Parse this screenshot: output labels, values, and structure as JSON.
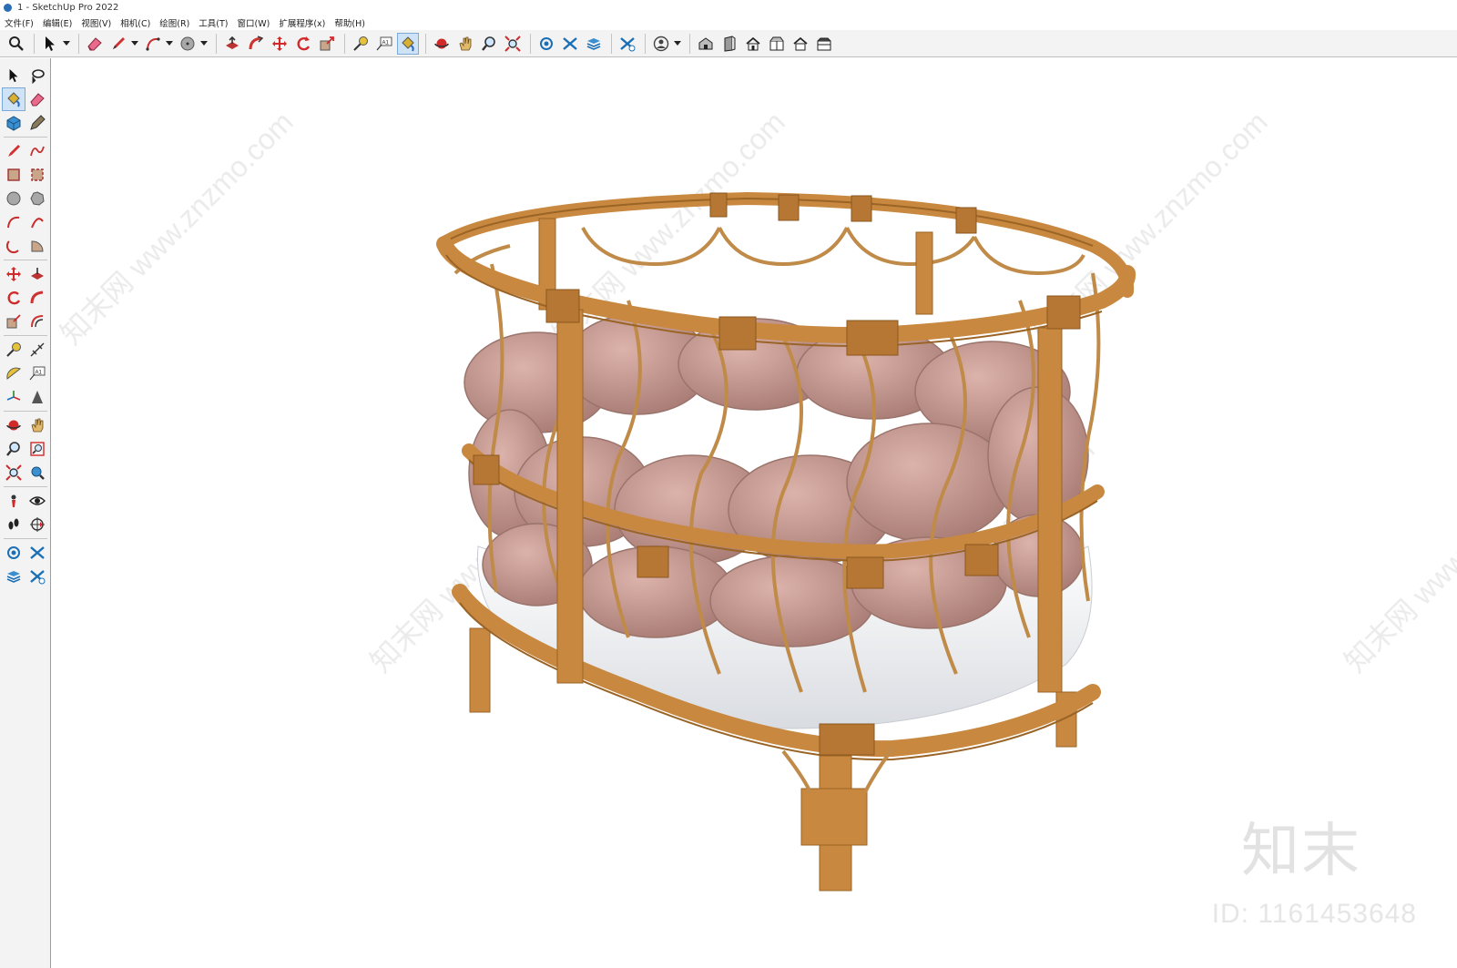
{
  "window": {
    "title": "1 - SketchUp Pro 2022"
  },
  "menubar": {
    "items": [
      "文件(F)",
      "编辑(E)",
      "视图(V)",
      "相机(C)",
      "绘图(R)",
      "工具(T)",
      "窗口(W)",
      "扩展程序(x)",
      "帮助(H)"
    ]
  },
  "toolbar": {
    "active_tool": "paint-bucket",
    "groups": [
      [
        "search"
      ],
      [
        "select",
        "dropdown"
      ],
      [
        "eraser",
        "pencil-line",
        "dropdown",
        "arc",
        "dropdown",
        "circle",
        "dropdown"
      ],
      [
        "push-pull",
        "follow-me",
        "move",
        "rotate",
        "scale"
      ],
      [
        "tape-measure",
        "text",
        "paint-bucket"
      ],
      [
        "orbit",
        "pan",
        "zoom",
        "zoom-extents"
      ],
      [
        "warehouse",
        "extension-warehouse",
        "layout"
      ],
      [
        "send-to-layout"
      ],
      [
        "user",
        "dropdown"
      ],
      [
        "iso-view",
        "right-view",
        "front-view",
        "top-view",
        "back-view",
        "left-view"
      ]
    ]
  },
  "left_toolbar": {
    "active_tool": "paint-bucket"
  },
  "viewport": {
    "watermark_logo": "知末",
    "watermark_id": "ID: 1161453648",
    "diagonal_watermark": "知末网 www.znzmo.com",
    "colors": {
      "rattan": "#c8883f",
      "rattan_dark": "#9a6426",
      "braid": "#c99c94",
      "braid_dark": "#a87c74",
      "mattress": "#eef0f3"
    }
  }
}
